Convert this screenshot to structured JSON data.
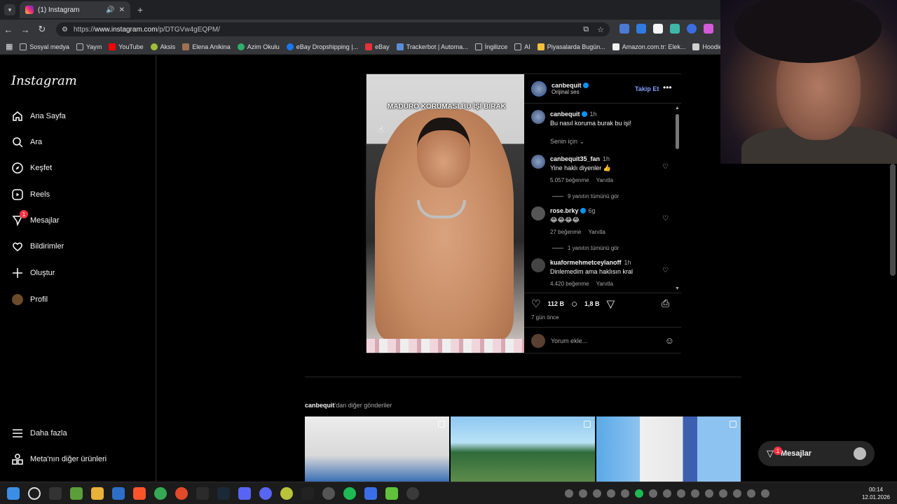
{
  "browser": {
    "tab_title": "(1) Instagram",
    "url_prefix": "https://",
    "url_host": "www.instagram.com",
    "url_path": "/p/DTGVw4gEQPM/",
    "bookmarks": [
      "Sosyal medya",
      "Yayın",
      "YouTube",
      "Aksis",
      "Elena Anikina",
      "Azim Okulu",
      "eBay Dropshipping |...",
      "eBay",
      "Trackerbot | Automa...",
      "İngilizce",
      "AI",
      "Piyasalarda Bugün...",
      "Amazon.com.tr: Elek...",
      "Hoodie Modelleri |"
    ]
  },
  "sidebar": {
    "logo": "Instagram",
    "items": [
      {
        "label": "Ana Sayfa",
        "icon": "home-icon"
      },
      {
        "label": "Ara",
        "icon": "search-icon"
      },
      {
        "label": "Keşfet",
        "icon": "compass-icon"
      },
      {
        "label": "Reels",
        "icon": "reels-icon"
      },
      {
        "label": "Mesajlar",
        "icon": "messenger-icon",
        "badge": "1"
      },
      {
        "label": "Bildirimler",
        "icon": "heart-icon"
      },
      {
        "label": "Oluştur",
        "icon": "plus-icon"
      },
      {
        "label": "Profil",
        "icon": "avatar"
      }
    ],
    "bottom": [
      {
        "label": "Daha fazla",
        "icon": "menu-icon"
      },
      {
        "label": "Meta'nın diğer ürünleri",
        "icon": "meta-products-icon"
      }
    ]
  },
  "post": {
    "overlay_caption": "MADURO KORUMASI BU İŞİ BIRAK",
    "author": "canbequit",
    "audio": "Orijinal ses",
    "follow_label": "Takip Et",
    "caption": {
      "user": "canbequit",
      "time": "1h",
      "text": "Bu nasıl koruma burak bu işi!"
    },
    "senin_icin": "Senin için",
    "comments": [
      {
        "user": "canbequit35_fan",
        "time": "1h",
        "text": "Yine haklı diyenler 👍",
        "likes": "5.057 beğenme",
        "reply": "Yanıtla",
        "more_replies": "9 yanıtın tümünü gör"
      },
      {
        "user": "rose.brky",
        "time": "6g",
        "text": "😂😂😂😂",
        "likes": "27 beğenme",
        "reply": "Yanıtla",
        "more_replies": "1 yanıtın tümünü gör"
      },
      {
        "user": "kuaformehmetceylanoff",
        "time": "1h",
        "text": "Dinlemedim ama haklısın kral",
        "likes": "4.420 beğenme",
        "reply": "Yanıtla"
      }
    ],
    "likes": "112 B",
    "comments_count": "1,8 B",
    "posted_ago": "7 gün önce",
    "comment_placeholder": "Yorum ekle..."
  },
  "more_posts": {
    "user": "canbequit",
    "suffix": "'dan diğer gönderiler"
  },
  "messages_pill": {
    "label": "Mesajlar",
    "badge": "1"
  },
  "taskbar": {
    "time": "00:14",
    "date": "12.01.2026"
  },
  "colors": {
    "accent": "#0095f6",
    "follow": "#85a1ff",
    "badge": "#ff3040"
  }
}
